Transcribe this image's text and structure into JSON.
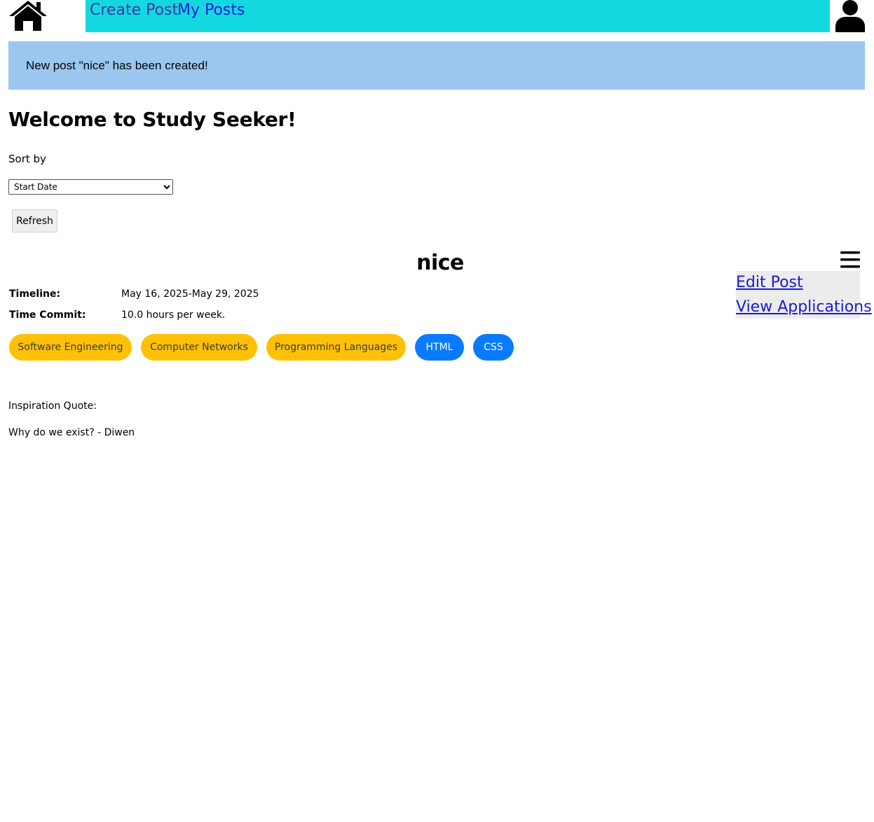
{
  "nav": {
    "home_icon": "home-icon",
    "create_post": "Create Post",
    "my_posts": "My Posts",
    "user_icon": "user-icon",
    "bar_color": "#14d8df"
  },
  "alert": {
    "message": "New post \"nice\" has been created!",
    "color": "#9bc7ee"
  },
  "main": {
    "heading": "Welcome to Study Seeker!",
    "sort_label": "Sort by",
    "sort_selected": "Start Date",
    "refresh_label": "Refresh"
  },
  "post": {
    "title": "nice",
    "menu_icon": "hamburger-menu-icon",
    "menu": {
      "edit": "Edit Post",
      "view_applications": "View Applications"
    },
    "timeline_label": "Timeline:",
    "timeline_value": "May 16, 2025-May 29, 2025",
    "time_commit_label": "Time Commit:",
    "time_commit_value": "10.0 hours per week.",
    "tags": [
      {
        "label": "Software Engineering",
        "color": "#ffc107"
      },
      {
        "label": "Computer Networks",
        "color": "#ffc107"
      },
      {
        "label": "Programming Languages",
        "color": "#ffc107"
      },
      {
        "label": "HTML",
        "color": "#0a7bff"
      },
      {
        "label": "CSS",
        "color": "#0a7bff"
      }
    ],
    "quote_label": "Inspiration Quote:",
    "quote_text": "Why do we exist? - Diwen"
  }
}
